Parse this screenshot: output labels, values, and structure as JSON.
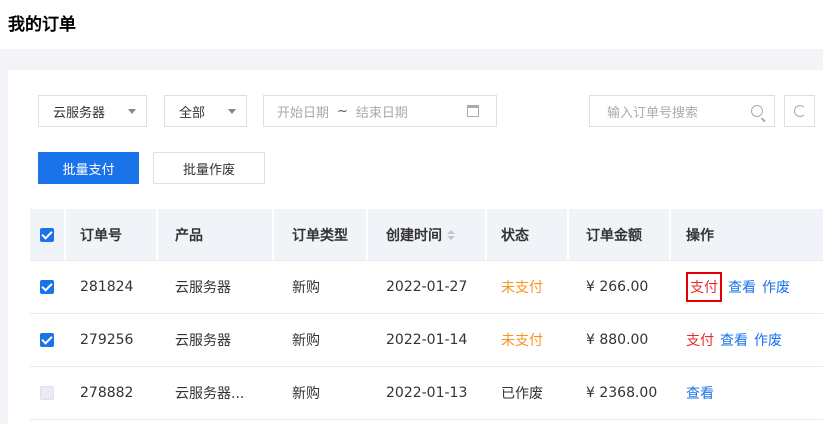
{
  "page": {
    "title": "我的订单"
  },
  "filters": {
    "product_select": "云服务器",
    "status_select": "全部",
    "date_start_placeholder": "开始日期",
    "date_separator": "~",
    "date_end_placeholder": "结束日期",
    "search_placeholder": "输入订单号搜索"
  },
  "actions": {
    "batch_pay": "批量支付",
    "batch_void": "批量作废"
  },
  "table": {
    "headers": {
      "order_id": "订单号",
      "product": "产品",
      "order_type": "订单类型",
      "created_at": "创建时间",
      "status": "状态",
      "amount": "订单金额",
      "operations": "操作"
    },
    "header_checked": true,
    "rows": [
      {
        "checked": true,
        "order_id": "281824",
        "product": "云服务器",
        "order_type": "新购",
        "created_at": "2022-01-27",
        "status": "未支付",
        "amount": "¥ 266.00",
        "op_pay": "支付",
        "op_view": "查看",
        "op_void": "作废"
      },
      {
        "checked": true,
        "order_id": "279256",
        "product": "云服务器",
        "order_type": "新购",
        "created_at": "2022-01-14",
        "status": "未支付",
        "amount": "¥ 880.00",
        "op_pay": "支付",
        "op_view": "查看",
        "op_void": "作废"
      },
      {
        "checked": false,
        "order_id": "278882",
        "product": "云服务器...",
        "order_type": "新购",
        "created_at": "2022-01-13",
        "status": "已作废",
        "amount": "¥ 2368.00",
        "op_view": "查看"
      }
    ]
  },
  "colors": {
    "primary": "#1a73e8",
    "unpaid": "#f7941d",
    "pay_link": "#e62c2c",
    "highlight_box": "#e00000"
  }
}
